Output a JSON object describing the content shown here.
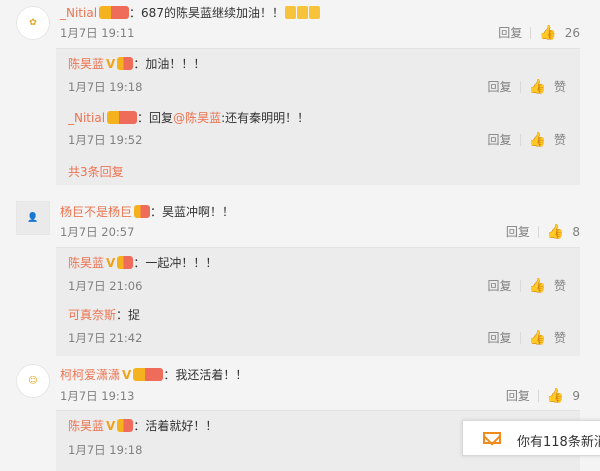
{
  "comments": [
    {
      "username": "_Nitial",
      "text": "：687的陈昊蓝继续加油！！",
      "time": "1月7日 19:11",
      "reply_label": "回复",
      "likes": "26",
      "replies": [
        {
          "username": "陈昊蓝",
          "text": "：加油！！！",
          "time": "1月7日 19:18",
          "reply_label": "回复",
          "like_label": "赞"
        },
        {
          "username": "_Nitial",
          "text_prefix": "：回复",
          "mention": "@陈昊蓝",
          "text": ":还有秦明明！！",
          "time": "1月7日 19:52",
          "reply_label": "回复",
          "like_label": "赞"
        }
      ],
      "more_replies": "共3条回复"
    },
    {
      "username": "杨巨不是杨巨",
      "text": "：昊蓝冲啊！！",
      "time": "1月7日 20:57",
      "reply_label": "回复",
      "likes": "8",
      "replies": [
        {
          "username": "陈昊蓝",
          "text": "：一起冲！！！",
          "time": "1月7日 21:06",
          "reply_label": "回复",
          "like_label": "赞"
        },
        {
          "username": "可真奈斯",
          "text": "：捉",
          "time": "1月7日 21:42",
          "reply_label": "回复",
          "like_label": "赞"
        }
      ]
    },
    {
      "username": "柯柯爱潇潇",
      "text": "：我还活着！！",
      "time": "1月7日 19:13",
      "reply_label": "回复",
      "likes": "9",
      "replies": [
        {
          "username": "陈昊蓝",
          "text": "：活着就好！！",
          "time": "1月7日 19:18"
        }
      ]
    }
  ],
  "notification": {
    "text": "你有118条新消"
  },
  "colors": {
    "username": "#eb7350",
    "background": "#f4f4f4"
  }
}
